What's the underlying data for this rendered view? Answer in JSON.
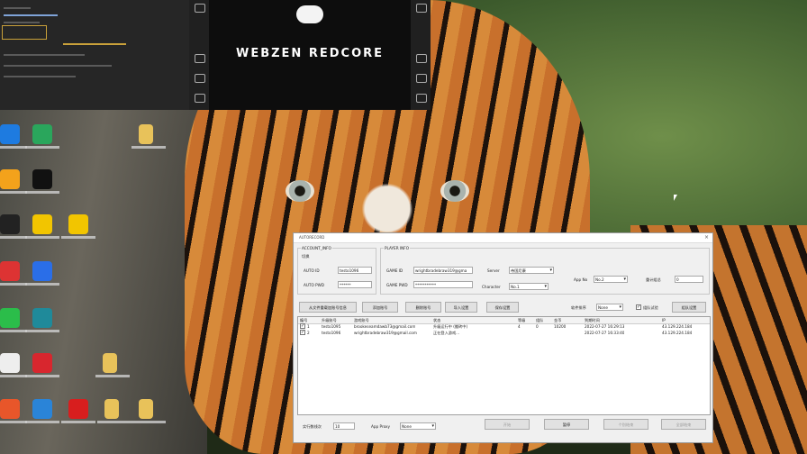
{
  "remote_panel": {
    "brand": "WEBZEN REDCORE"
  },
  "desktop": {
    "icons_col1": [
      {
        "name": "todesk-icon",
        "color": "#1e7be0"
      },
      {
        "name": "orange-app-icon",
        "color": "#f3a21b"
      },
      {
        "name": "qq-icon",
        "color": "#222"
      },
      {
        "name": "red-a-icon",
        "color": "#d33"
      },
      {
        "name": "green-chat-icon",
        "color": "#2bbd4a"
      },
      {
        "name": "blank-doc-icon",
        "color": "#eee"
      },
      {
        "name": "huawei-icon",
        "color": "#e8562a"
      }
    ],
    "icons_col2": [
      {
        "name": "shield-icon",
        "color": "#2aa65c"
      },
      {
        "name": "capcut-icon",
        "color": "#111"
      },
      {
        "name": "yellow-app-icon",
        "color": "#f2c500"
      },
      {
        "name": "blue-shield-icon",
        "color": "#2a6ee8"
      },
      {
        "name": "teal-circle-icon",
        "color": "#1f8a9a"
      },
      {
        "name": "netease-music-icon",
        "color": "#d8262e"
      },
      {
        "name": "vscode-icon",
        "color": "#2a84d8"
      }
    ],
    "icons_col3": [
      {
        "name": "yellow-circle-icon",
        "color": "#f2c500"
      },
      {
        "name": "youdao-icon",
        "color": "#d81e1e"
      }
    ],
    "folder_icons": [
      {
        "name": "folder-icon-1"
      },
      {
        "name": "folder-icon-2"
      },
      {
        "name": "folder-icon-3"
      },
      {
        "name": "folder-icon-4"
      }
    ]
  },
  "window": {
    "title": "AUTORECORD",
    "account_group": "ACCOUNT_INFO",
    "account_sub": "切换",
    "auto_id_label": "AUTO ID",
    "auto_id_value": "testo1096",
    "auto_pwd_label": "AUTO PWD",
    "auto_pwd_value": "******",
    "player_group": "PLAYER INFO",
    "game_id_label": "GAME ID",
    "game_id_value": "wrightbradebraw319@gma",
    "game_pwd_label": "GAME PWD",
    "game_pwd_value": "***********",
    "server_label": "Server",
    "server_value": "帝国尼康",
    "character_label": "Character",
    "character_value": "No.1",
    "app_no_label": "App No",
    "app_no_value": "No.2",
    "count_label": "重计组总",
    "count_value": "0",
    "buttons": [
      "从文件重载加账号信息",
      "添加账号",
      "删除账号",
      "导入设置",
      "保存设置"
    ],
    "soft_sort_label": "软件排序",
    "soft_sort_value": "None",
    "group_check_label": "组队试验",
    "group_settings_btn": "组队设置",
    "table": {
      "headers": [
        "编号",
        "升级账号",
        "游戏账号",
        "状态",
        "等级",
        "组队",
        "金币",
        "到期时间",
        "IP"
      ],
      "rows": [
        [
          "1",
          "testo1095",
          "brookeseamdawb73@gmail.com",
          "升级运行中 (搬砖中)",
          "4",
          "0",
          "10200",
          "2022-07-27 16:29:13",
          "43.129.224.184"
        ],
        [
          "2",
          "testo1096",
          "wrightbradebraw319@gmail.com",
          "正在登入游戏...",
          "",
          "",
          "",
          "2022-07-27 16:33:40",
          "43.129.224.184"
        ]
      ]
    },
    "bottom": {
      "exec_label": "实行数线次",
      "exec_value": "10",
      "proxy_label": "App Proxy",
      "proxy_value": "None",
      "btn_start": "开始",
      "btn_pause": "暂停",
      "btn_stop": "个别结束",
      "btn_all_stop": "全部结束"
    }
  }
}
